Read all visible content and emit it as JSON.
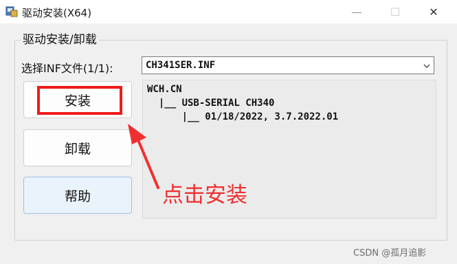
{
  "window": {
    "title": "驱动安装(X64)",
    "controls": {
      "minimize": "—",
      "maximize": "☐",
      "close": "✕"
    }
  },
  "group": {
    "title": "驱动安装/卸载",
    "select_label": "选择INF文件(1/1):",
    "select_value": "CH341SER.INF"
  },
  "buttons": {
    "install": "安装",
    "uninstall": "卸载",
    "help": "帮助"
  },
  "info": {
    "lines": [
      "WCH.CN",
      "  |__ USB-SERIAL CH340",
      "      |__ 01/18/2022, 3.7.2022.01"
    ]
  },
  "annotation": {
    "text": "点击安装",
    "color": "#f03030"
  },
  "watermark": "CSDN @孤月追影",
  "colors": {
    "highlight": "#f01a1a",
    "background": "#f0f0f0"
  }
}
